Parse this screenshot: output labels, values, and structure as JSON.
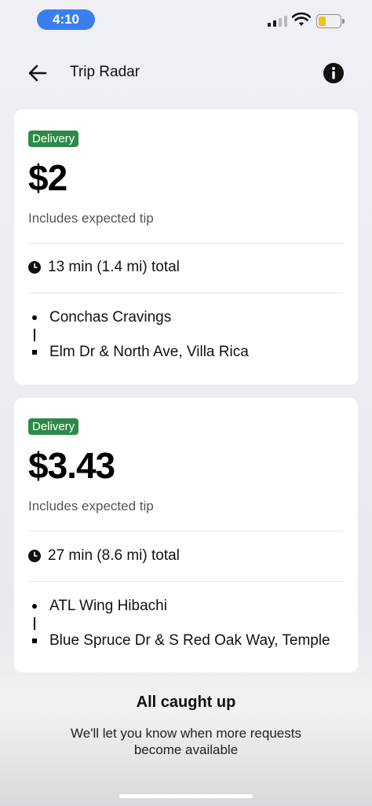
{
  "status_bar": {
    "time": "4:10"
  },
  "nav": {
    "title": "Trip Radar"
  },
  "trips": [
    {
      "badge": "Delivery",
      "price": "$2",
      "tip_note": "Includes expected tip",
      "duration": "13 min (1.4 mi) total",
      "pickup": "Conchas Cravings",
      "dropoff": "Elm Dr & North Ave, Villa Rica"
    },
    {
      "badge": "Delivery",
      "price": "$3.43",
      "tip_note": "Includes expected tip",
      "duration": "27 min (8.6 mi) total",
      "pickup": "ATL Wing Hibachi",
      "dropoff": "Blue Spruce Dr & S Red Oak Way, Temple"
    }
  ],
  "empty_state": {
    "title": "All caught up",
    "subtitle": "We'll let you know when more requests become available"
  },
  "colors": {
    "badge": "#2c8a46",
    "time_pill": "#3a7ff2",
    "battery": "#f4c31a"
  }
}
